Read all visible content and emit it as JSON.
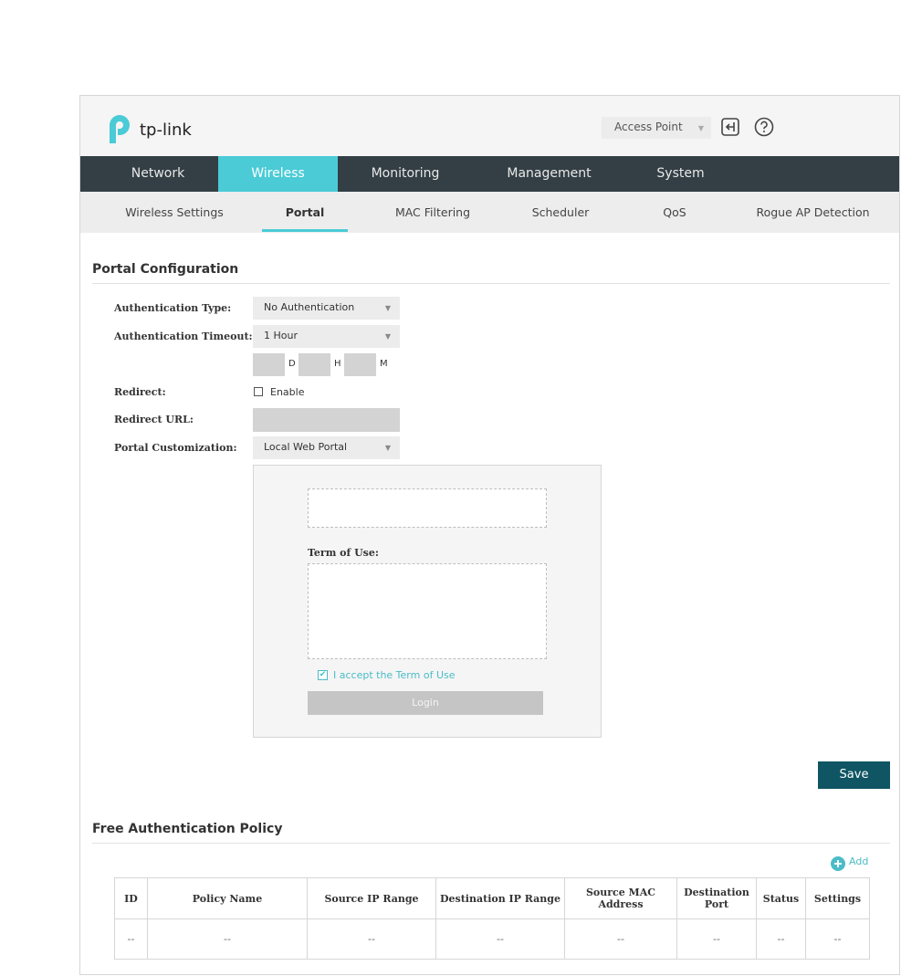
{
  "header": {
    "brand": "tp-link",
    "mode_select": "Access Point",
    "colors": {
      "accent": "#4acbd6",
      "nav_bg": "#333f45",
      "save_bg": "#0f5563",
      "link": "#4bbcc7"
    },
    "icons": [
      "logout-icon",
      "help-icon"
    ]
  },
  "main_nav": [
    "Network",
    "Wireless",
    "Monitoring",
    "Management",
    "System"
  ],
  "sub_nav": [
    "Wireless Settings",
    "Portal",
    "MAC Filtering",
    "Scheduler",
    "QoS",
    "Rogue AP Detection"
  ],
  "portal": {
    "title": "Portal Configuration",
    "auth_type_label": "Authentication Type:",
    "auth_type_value": "No Authentication",
    "auth_timeout_label": "Authentication Timeout:",
    "auth_timeout_value": "1 Hour",
    "unit_d": "D",
    "unit_h": "H",
    "unit_m": "M",
    "redirect_label": "Redirect:",
    "redirect_enable": "Enable",
    "redirect_url_label": "Redirect URL:",
    "customization_label": "Portal Customization:",
    "customization_value": "Local Web Portal",
    "preview": {
      "terms_label": "Term of Use:",
      "accept_text": "I accept the Term of Use",
      "login_label": "Login"
    },
    "save_label": "Save"
  },
  "policy": {
    "title": "Free Authentication Policy",
    "add_label": "Add",
    "columns": [
      "ID",
      "Policy Name",
      "Source IP Range",
      "Destination IP Range",
      "Source MAC Address",
      "Destination Port",
      "Status",
      "Settings"
    ],
    "rows": [
      [
        "--",
        "--",
        "--",
        "--",
        "--",
        "--",
        "--",
        "--"
      ]
    ]
  }
}
